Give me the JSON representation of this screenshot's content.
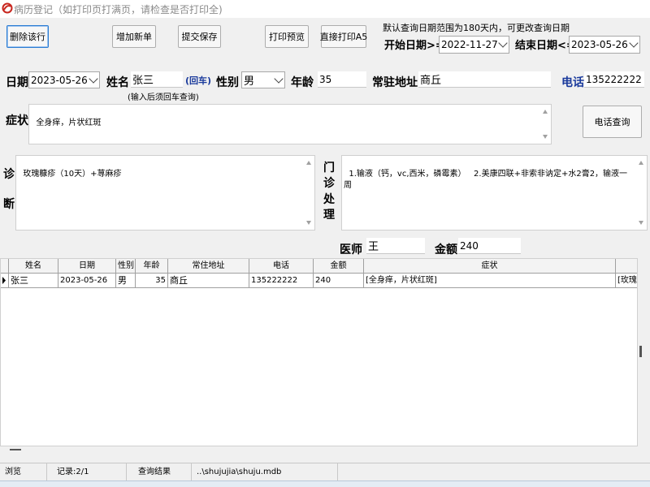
{
  "window": {
    "title": "病历登记（如打印页打满页，请检查是否打印全)"
  },
  "toolbar": {
    "delete": "删除该行",
    "add": "增加新单",
    "submit": "提交保存",
    "preview": "打印预览",
    "print_a5": "直接打印A5"
  },
  "query": {
    "note": "默认查询日期范围为180天内，可更改查询日期",
    "start_label": "开始日期>=",
    "start_value": "2022-11-27",
    "end_label": "结束日期<=",
    "end_value": "2023-05-26"
  },
  "form": {
    "date_label": "日期",
    "date_value": "2023-05-26",
    "name_label": "姓名",
    "name_value": "张三",
    "enter_tag": "(回车)",
    "name_hint": "(输入后须回车查询)",
    "gender_label": "性别",
    "gender_value": "男",
    "age_label": "年龄",
    "age_value": "35",
    "address_label": "常驻地址",
    "address_value": "商丘",
    "phone_label": "电话",
    "phone_value": "135222222",
    "symptom_label": "症状",
    "symptom_value": "全身痒，片状红斑",
    "phone_query_button": "电话查询",
    "diagnosis_label_1": "诊",
    "diagnosis_label_2": "断",
    "diagnosis_value": "玫瑰糠疹（10天）+荨麻疹",
    "treatment_label_1": "门",
    "treatment_label_2": "诊",
    "treatment_label_3": "处",
    "treatment_label_4": "理",
    "treatment_value": "1.输液（钙，vc,西米，磷霉素）   2.美康四联+非索非讷定+水2膏2，输液一周",
    "doctor_label": "医师",
    "doctor_value": "王",
    "amount_label": "金额",
    "amount_value": "240"
  },
  "grid": {
    "columns": [
      "姓名",
      "日期",
      "性别",
      "年龄",
      "常住地址",
      "电话",
      "金额",
      "症状",
      ""
    ],
    "rows": [
      [
        "张三",
        "2023-05-26",
        "男",
        "35",
        "商丘",
        "135222222",
        "240",
        "[全身痒，片状红斑]",
        "[玫瑰"
      ]
    ]
  },
  "status": {
    "mode": "浏览",
    "record": "记录:2/1",
    "result": "查询结果",
    "path": "..\\shujujia\\shuju.mdb"
  },
  "colors": {
    "accent_blue": "#1a3a9c",
    "focus_border": "#2b7cd3"
  }
}
